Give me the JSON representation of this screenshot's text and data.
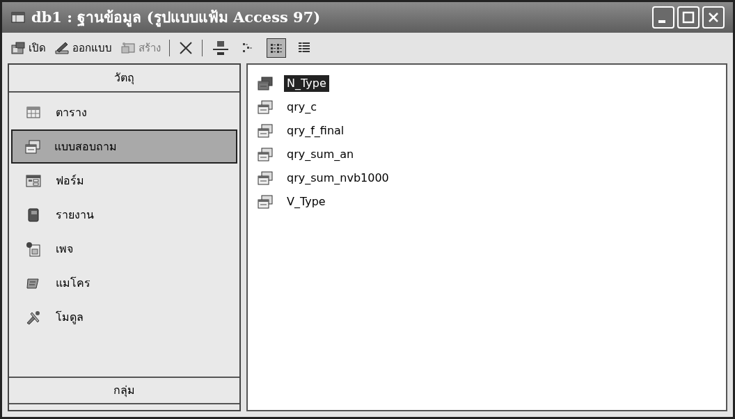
{
  "window": {
    "title": "db1 : ฐานข้อมูล (รูปแบบแฟ้ม Access 97)"
  },
  "toolbar": {
    "buttons": [
      {
        "kind": "open",
        "label": "เปิด"
      },
      {
        "kind": "design",
        "label": "ออกแบบ"
      },
      {
        "kind": "new",
        "label": "สร้าง"
      }
    ],
    "views": [
      {
        "kind": "large",
        "selected": false
      },
      {
        "kind": "small",
        "selected": false
      },
      {
        "kind": "list",
        "selected": true
      },
      {
        "kind": "details",
        "selected": false
      }
    ]
  },
  "sidebar": {
    "header": "วัตถุ",
    "items": [
      {
        "kind": "table",
        "label": "ตาราง",
        "selected": false
      },
      {
        "kind": "query",
        "label": "แบบสอบถาม",
        "selected": true
      },
      {
        "kind": "form",
        "label": "ฟอร์ม",
        "selected": false
      },
      {
        "kind": "report",
        "label": "รายงาน",
        "selected": false
      },
      {
        "kind": "page",
        "label": "เพจ",
        "selected": false
      },
      {
        "kind": "macro",
        "label": "แมโคร",
        "selected": false
      },
      {
        "kind": "module",
        "label": "โมดูล",
        "selected": false
      }
    ],
    "footer": "กลุ่ม"
  },
  "objects": [
    {
      "label": "N_Type",
      "selected": true
    },
    {
      "label": "qry_c",
      "selected": false
    },
    {
      "label": "qry_f_final",
      "selected": false
    },
    {
      "label": "qry_sum_an",
      "selected": false
    },
    {
      "label": "qry_sum_nvb1000",
      "selected": false
    },
    {
      "label": "V_Type",
      "selected": false
    }
  ]
}
